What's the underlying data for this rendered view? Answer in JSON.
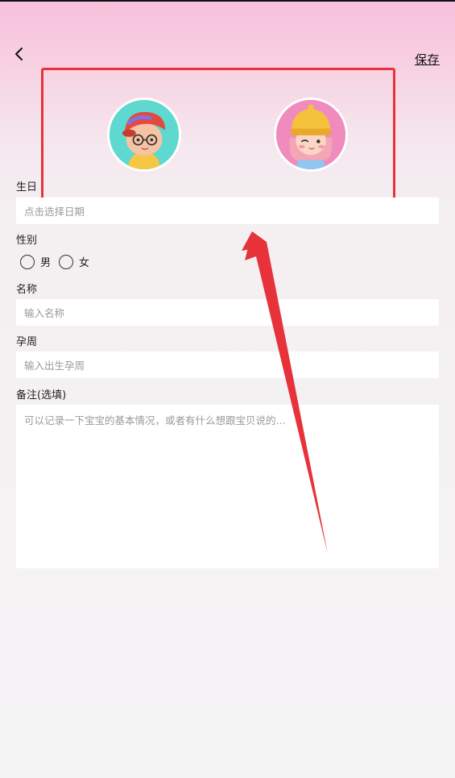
{
  "header": {
    "back_icon": "chevron-left-icon",
    "save_label": "保存"
  },
  "avatars": [
    {
      "name": "boy",
      "selected": false
    },
    {
      "name": "girl",
      "selected": false
    }
  ],
  "form": {
    "birthday": {
      "label": "生日",
      "placeholder": "点击选择日期"
    },
    "gender": {
      "label": "性别",
      "options": [
        "男",
        "女"
      ]
    },
    "name": {
      "label": "名称",
      "placeholder": "输入名称"
    },
    "gestation": {
      "label": "孕周",
      "placeholder": "输入出生孕周"
    },
    "notes": {
      "label": "备注(选填)",
      "placeholder": "可以记录一下宝宝的基本情况，或者有什么想跟宝贝说的..."
    }
  },
  "annotation": {
    "highlight_color": "#e8323a"
  }
}
